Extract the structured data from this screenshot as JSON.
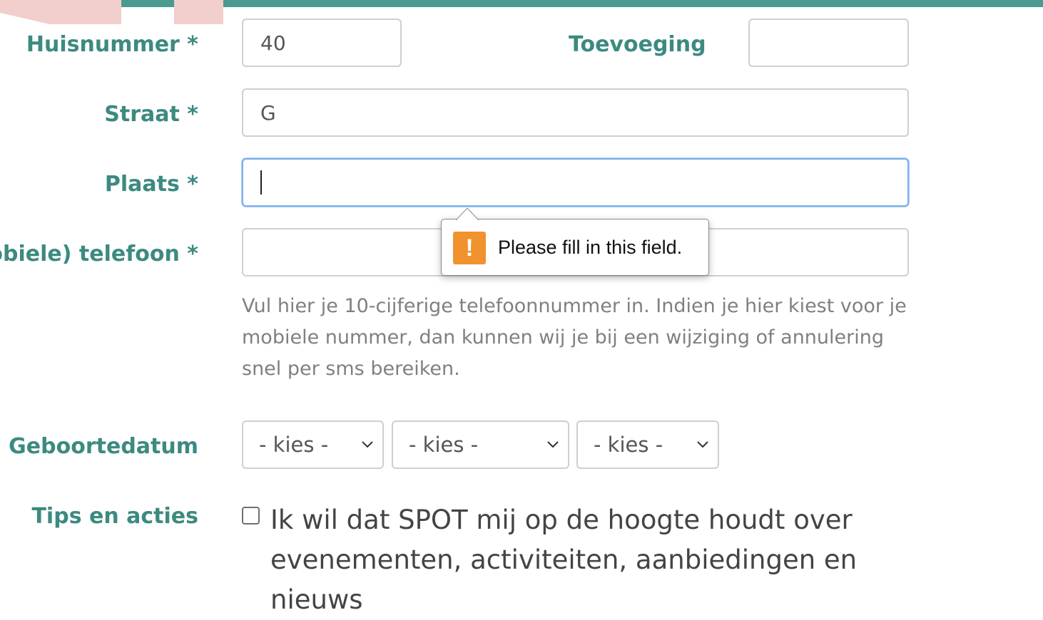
{
  "colors": {
    "top_bar": "#4a9a8f",
    "decoration": "#f2cfcc",
    "label": "#3c8a80",
    "focus_border": "#7fb0ec",
    "warning_icon": "#f0922e"
  },
  "form": {
    "huisnummer": {
      "label": "Huisnummer *",
      "value": "40"
    },
    "toevoeging": {
      "label": "Toevoeging",
      "value": ""
    },
    "straat": {
      "label": "Straat *",
      "value": "G"
    },
    "plaats": {
      "label": "Plaats *",
      "value": "",
      "focused": true
    },
    "telefoon": {
      "label": "obiele) telefoon *",
      "value": "",
      "help": "Vul hier je 10-cijferige telefoonnummer in. Indien je hier kiest voor je mobiele nummer, dan kunnen wij je bij een wijziging of annulering snel per sms bereiken."
    },
    "geboortedatum": {
      "label": "Geboortedatum",
      "day": "- kies -",
      "month": "- kies -",
      "year": "- kies -"
    },
    "tips": {
      "label": "Tips en acties",
      "checkbox_text": "Ik wil dat SPOT mij op de hoogte houdt over evenementen, activiteiten, aanbiedingen en nieuws",
      "checked": false
    }
  },
  "validation_tooltip": {
    "icon": "warning-icon",
    "icon_glyph": "!",
    "message": "Please fill in this field."
  }
}
